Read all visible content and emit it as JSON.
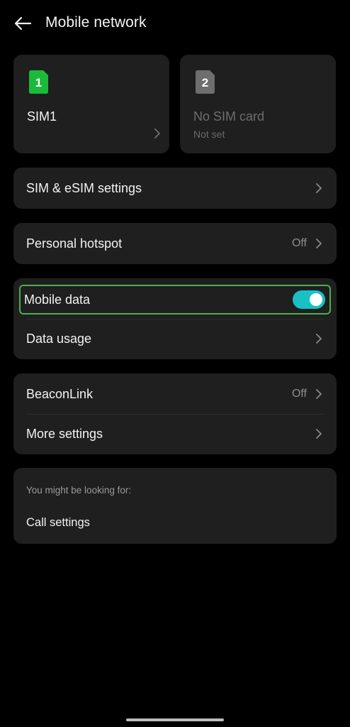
{
  "header": {
    "title": "Mobile network",
    "back_icon": "arrow-left-icon"
  },
  "sims": [
    {
      "slot": "1",
      "name": "SIM1",
      "subtitle": "",
      "badge_color": "#1db93b"
    },
    {
      "slot": "2",
      "name": "No SIM card",
      "subtitle": "Not set",
      "badge_color": "#6e6e6e"
    }
  ],
  "rows": {
    "sim_esim": {
      "label": "SIM & eSIM settings"
    },
    "hotspot": {
      "label": "Personal hotspot",
      "value": "Off"
    },
    "mobile_data": {
      "label": "Mobile data",
      "enabled": true,
      "toggle_color": "#19c0c4"
    },
    "data_usage": {
      "label": "Data usage"
    },
    "beaconlink": {
      "label": "BeaconLink",
      "value": "Off"
    },
    "more_settings": {
      "label": "More settings"
    }
  },
  "suggestions": {
    "heading": "You might be looking for:",
    "items": [
      "Call settings"
    ]
  }
}
